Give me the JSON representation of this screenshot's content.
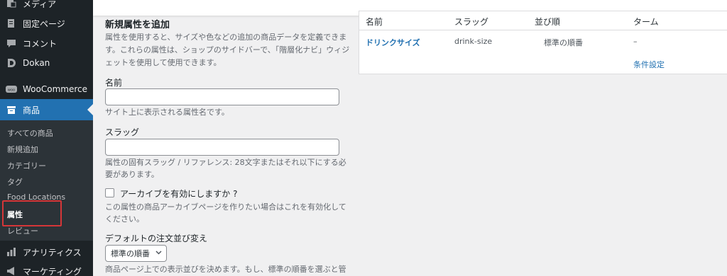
{
  "sidebar": {
    "menu": [
      {
        "label": "メディア",
        "icon": "media-icon"
      },
      {
        "label": "固定ページ",
        "icon": "page-icon"
      },
      {
        "label": "コメント",
        "icon": "comment-icon"
      },
      {
        "label": "Dokan",
        "icon": "dokan-icon"
      },
      {
        "label": "WooCommerce",
        "icon": "woocommerce-icon"
      },
      {
        "label": "商品",
        "icon": "products-icon"
      }
    ],
    "submenu": [
      "すべての商品",
      "新規追加",
      "カテゴリー",
      "タグ",
      "Food Locations",
      "属性",
      "レビュー"
    ],
    "bottom_menu": [
      {
        "label": "アナリティクス",
        "icon": "analytics-icon"
      },
      {
        "label": "マーケティング",
        "icon": "marketing-icon"
      }
    ]
  },
  "form": {
    "title": "新規属性を追加",
    "intro": [
      "属性を使用すると、サイズや色などの追加の商品データを定義できま",
      "す。これらの属性は、ショップのサイドバーで、「階層化ナビ」ウィジ",
      "ェットを使用して使用できます。"
    ],
    "name_label": "名前",
    "name_value": "",
    "name_help": "サイト上に表示される属性名です。",
    "slug_label": "スラッグ",
    "slug_value": "",
    "slug_help": [
      "属性の固有スラッグ / リファレンス: 28文字またはそれ以下にする必",
      "要があります。"
    ],
    "archive_label": "アーカイブを有効にしますか ?",
    "archive_checked": false,
    "archive_help": [
      "この属性の商品アーカイブページを作りたい場合はこれを有効化して",
      "ください。"
    ],
    "orderby_label": "デフォルトの注文並び変え",
    "orderby_value": "標準の順番",
    "orderby_help": "商品ページ上での表示並びを決めます。もし、標準の順番を選ぶと管"
  },
  "table": {
    "headers": [
      "名前",
      "スラッグ",
      "並び順",
      "ターム"
    ],
    "rows": [
      {
        "name": "ドリンクサイズ",
        "slug": "drink-size",
        "order": "標準の順番",
        "terms": "–",
        "action": "条件設定"
      }
    ]
  }
}
